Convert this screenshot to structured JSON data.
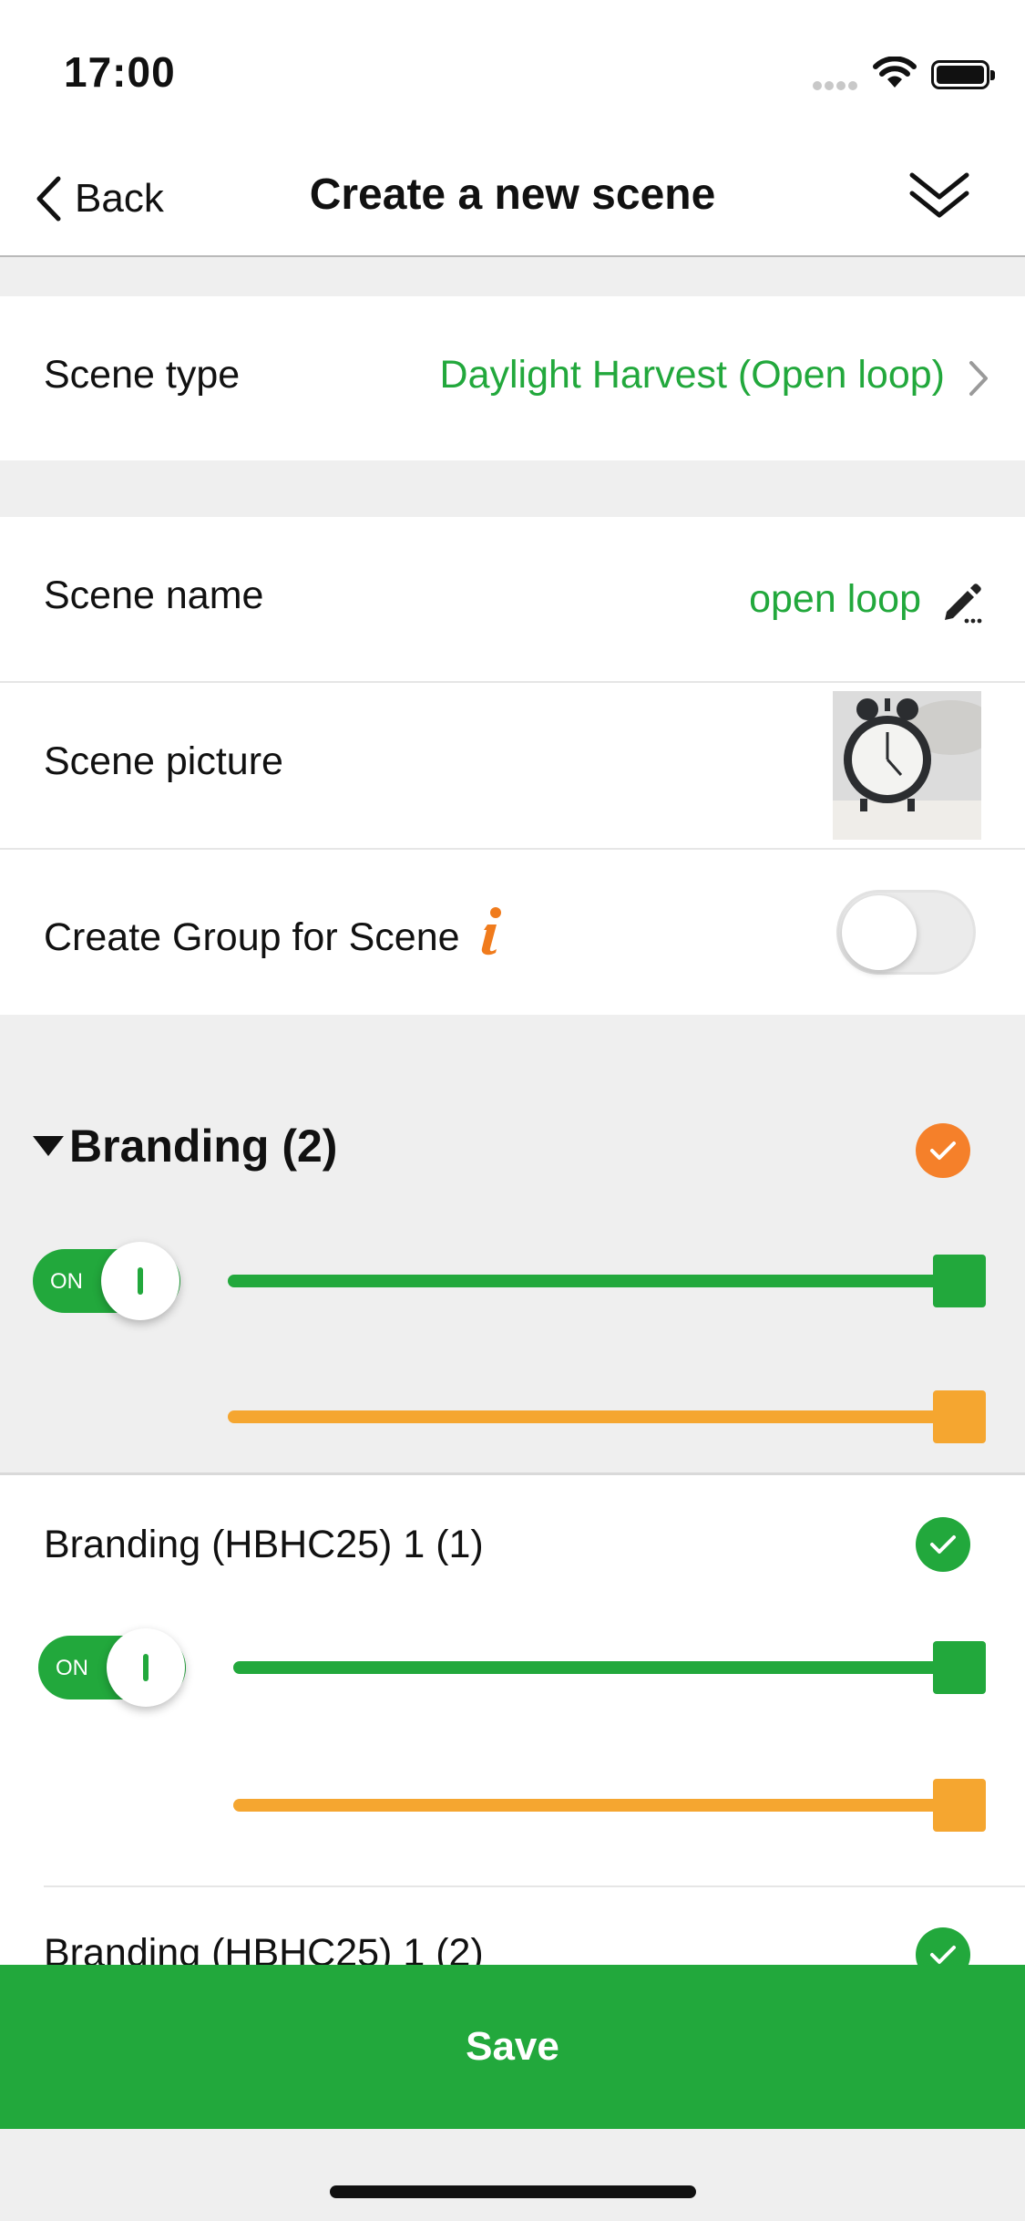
{
  "status_bar": {
    "time": "17:00"
  },
  "nav": {
    "back_label": "Back",
    "title": "Create a new scene"
  },
  "scene_type": {
    "label": "Scene type",
    "value": "Daylight Harvest (Open loop)"
  },
  "scene_name": {
    "label": "Scene name",
    "value": "open loop"
  },
  "scene_picture": {
    "label": "Scene picture"
  },
  "create_group": {
    "label": "Create Group for Scene",
    "enabled": false
  },
  "group": {
    "title": "Branding (2)",
    "selected": true,
    "power_label": "ON",
    "brightness_level": 1.0,
    "color_temp_level": 1.0
  },
  "devices": [
    {
      "name": "Branding (HBHC25) 1 (1)",
      "selected": true,
      "power_label": "ON",
      "brightness_level": 1.0,
      "color_temp_level": 1.0
    },
    {
      "name": "Branding (HBHC25) 1 (2)",
      "selected": true
    }
  ],
  "save_label": "Save",
  "colors": {
    "accent_green": "#22a83c",
    "accent_orange": "#f5802a",
    "slider_orange": "#f5a630"
  }
}
